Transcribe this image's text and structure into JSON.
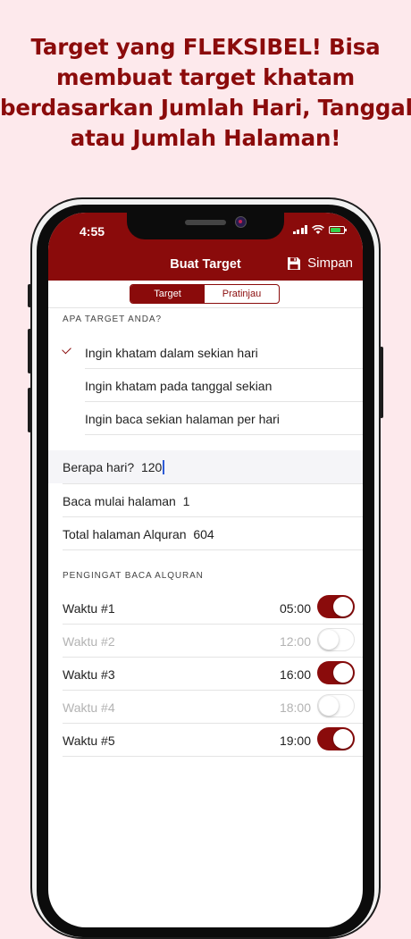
{
  "headline": {
    "line1": "Target yang FLEKSIBEL! Bisa",
    "line2": "membuat target khatam",
    "line3": "berdasarkan Jumlah Hari, Tanggal",
    "line4": "atau Jumlah Halaman!"
  },
  "status_bar": {
    "time": "4:55",
    "battery_color": "#35d04a"
  },
  "nav": {
    "title": "Buat Target",
    "save_label": "Simpan",
    "save_icon": "floppy-disk-icon"
  },
  "segments": {
    "active": "Target",
    "inactive": "Pratinjau"
  },
  "target_section": {
    "header": "APA TARGET ANDA?",
    "options": [
      {
        "label": "Ingin khatam dalam sekian hari",
        "checked": true
      },
      {
        "label": "Ingin khatam pada tanggal sekian",
        "checked": false
      },
      {
        "label": "Ingin baca sekian halaman per hari",
        "checked": false
      }
    ]
  },
  "fields": {
    "days_label": "Berapa hari?",
    "days_value": "120",
    "start_page_label": "Baca mulai halaman",
    "start_page_value": "1",
    "total_pages_label": "Total halaman Alquran",
    "total_pages_value": "604"
  },
  "reminders": {
    "header": "PENGINGAT BACA ALQURAN",
    "items": [
      {
        "label": "Waktu #1",
        "time": "05:00",
        "enabled": true
      },
      {
        "label": "Waktu #2",
        "time": "12:00",
        "enabled": false
      },
      {
        "label": "Waktu #3",
        "time": "16:00",
        "enabled": true
      },
      {
        "label": "Waktu #4",
        "time": "18:00",
        "enabled": false
      },
      {
        "label": "Waktu #5",
        "time": "19:00",
        "enabled": true
      }
    ]
  },
  "colors": {
    "brand": "#8a0b0b",
    "background": "#fde9ec",
    "caret": "#2d5bd6"
  }
}
